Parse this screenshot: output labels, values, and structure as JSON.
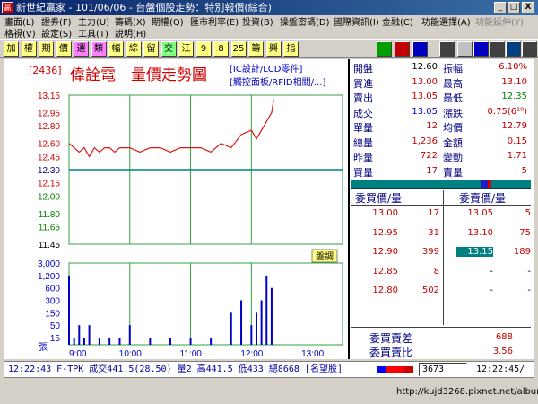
{
  "window": {
    "title": "新世紀贏家 - 101/06/06 - 台盤個股走勢：特別報價(綜合)",
    "min": "_",
    "max": "□",
    "close": "X"
  },
  "menu": {
    "row1": [
      "畫面(L)",
      "證券(F)",
      "主力(U)",
      "籌碼(X)",
      "期權(Q)",
      "匯市利率(E)",
      "投資(B)",
      "操盤密碼(D)",
      "國際資訊(I)",
      "金融(C)",
      "功能選擇(A)",
      "功能延伸(Y)"
    ],
    "row2": [
      "格視(V)",
      "設定(S)",
      "工具(T)",
      "說明(H)"
    ]
  },
  "toolbar": {
    "buttons": [
      "加",
      "權",
      "期",
      "價",
      "選",
      "類",
      "幅",
      "綜",
      "留",
      "交",
      "江",
      "9",
      "8",
      "25",
      "籌",
      "興",
      "指"
    ]
  },
  "chart": {
    "code": "[2436]",
    "name": "偉詮電",
    "subtitle": "量價走勢圖",
    "tags": [
      "[IC設計/LCD零件]",
      "[觸控面板/RFID相關/...]"
    ],
    "price_axis": [
      "13.15",
      "12.95",
      "12.80",
      "12.60",
      "12.45",
      "12.30",
      "12.15",
      "12.00",
      "11.80",
      "11.65",
      "11.45"
    ],
    "ref_price_label": "12.30",
    "volume_axis": [
      "3,000",
      "1,200",
      "600",
      "300",
      "150",
      "50",
      "15"
    ],
    "volume_unit": "張",
    "time_axis": [
      "9:00",
      "10:00",
      "11:00",
      "12:00",
      "13:00"
    ],
    "badge": "盤調",
    "colors": {
      "price_line": "#d81818",
      "volume_bar": "#0000c8",
      "grid": "#30a040",
      "ref_line": "#008080"
    }
  },
  "chart_data": {
    "type": "line",
    "price": {
      "x": [
        "09:00",
        "09:05",
        "09:10",
        "09:15",
        "09:20",
        "09:25",
        "09:30",
        "09:35",
        "09:40",
        "09:45",
        "09:50",
        "09:55",
        "10:00",
        "10:10",
        "10:20",
        "10:30",
        "10:40",
        "10:50",
        "11:00",
        "11:10",
        "11:20",
        "11:30",
        "11:40",
        "11:50",
        "12:00",
        "12:05",
        "12:10",
        "12:15",
        "12:20",
        "12:22"
      ],
      "y": [
        12.6,
        12.55,
        12.5,
        12.55,
        12.45,
        12.55,
        12.5,
        12.55,
        12.55,
        12.5,
        12.55,
        12.55,
        12.55,
        12.5,
        12.55,
        12.55,
        12.5,
        12.55,
        12.55,
        12.55,
        12.5,
        12.6,
        12.55,
        12.7,
        12.75,
        12.65,
        12.75,
        12.85,
        12.95,
        13.1
      ]
    },
    "volume": {
      "x": [
        "09:00",
        "09:05",
        "09:10",
        "09:15",
        "09:20",
        "09:30",
        "09:40",
        "09:50",
        "10:00",
        "10:20",
        "10:40",
        "11:00",
        "11:20",
        "11:40",
        "11:50",
        "12:00",
        "12:05",
        "12:10",
        "12:15",
        "12:20"
      ],
      "y": [
        1200,
        15,
        50,
        15,
        50,
        15,
        15,
        15,
        50,
        15,
        15,
        15,
        15,
        150,
        300,
        50,
        150,
        300,
        1200,
        600
      ]
    },
    "ylim_price": [
      11.45,
      13.15
    ],
    "xlim": [
      "09:00",
      "13:30"
    ]
  },
  "quote": {
    "rows": [
      {
        "l1": "開盤",
        "v1": "12.60",
        "l2": "振幅",
        "v2": "6.10%"
      },
      {
        "l1": "買進",
        "v1": "13.00",
        "l2": "最高",
        "v2": "13.10"
      },
      {
        "l1": "賣出",
        "v1": "13.05",
        "l2": "最低",
        "v2": "12.35"
      },
      {
        "l1": "成交",
        "v1": "13.05",
        "l2": "漲跌",
        "v2": "0.75(6¹⁰)"
      },
      {
        "l1": "單量",
        "v1": "12",
        "l2": "均價",
        "v2": "12.79"
      },
      {
        "l1": "總量",
        "v1": "1,236",
        "l2": "金額",
        "v2": "0.15"
      },
      {
        "l1": "昨量",
        "v1": "722",
        "l2": "變動",
        "v2": "1.71"
      },
      {
        "l1": "買量",
        "v1": "17",
        "l2": "賣量",
        "v2": "5"
      }
    ],
    "book_header_bid": "委買價/量",
    "book_header_ask": "委賣價/量",
    "book": [
      {
        "bp": "13.00",
        "bq": "17",
        "ap": "13.05",
        "aq": "5"
      },
      {
        "bp": "12.95",
        "bq": "31",
        "ap": "13.10",
        "aq": "75"
      },
      {
        "bp": "12.90",
        "bq": "399",
        "ap": "13.15",
        "aq": "189"
      },
      {
        "bp": "12.85",
        "bq": "8",
        "ap": "-",
        "aq": "-"
      },
      {
        "bp": "12.80",
        "bq": "502",
        "ap": "-",
        "aq": "-"
      }
    ],
    "diff_label": "委買賣差",
    "diff_value": "688",
    "ratio_label": "委買賣比",
    "ratio_value": "3.56"
  },
  "status": {
    "ticker": "12:22:43 F-TPK 成交441.5(28.50) 量2 高441.5 低433 總8668 [名望股]",
    "code": "3673",
    "time": "12:22:45/"
  },
  "footer": {
    "url": "http://kujd3268.pixnet.net/album"
  }
}
